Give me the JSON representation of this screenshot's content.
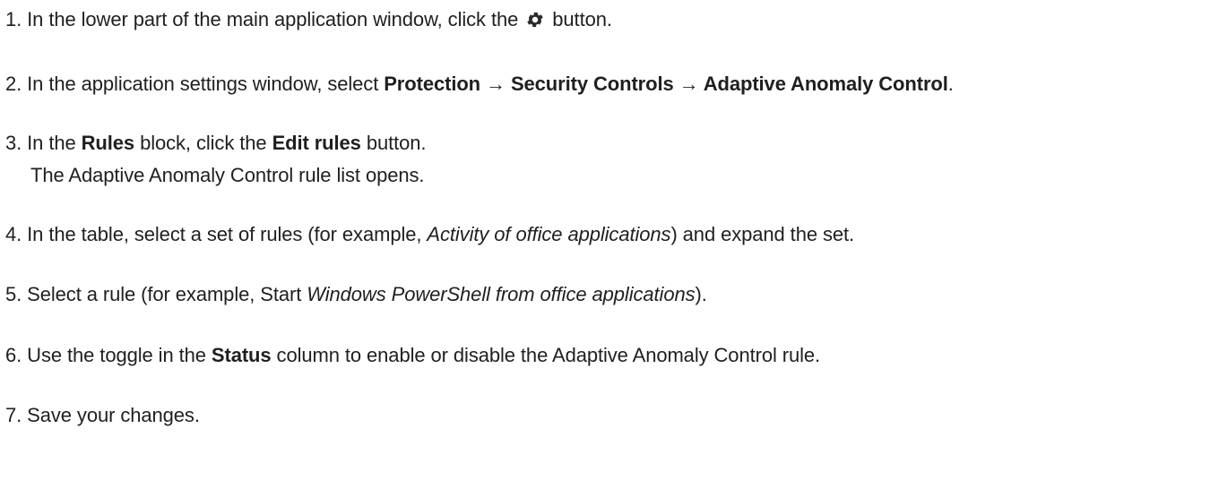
{
  "steps": [
    {
      "num": "1.",
      "a": "In the lower part of the main application window, click the",
      "icon": "gear-icon",
      "b": "button."
    },
    {
      "num": "2.",
      "a": "In the application settings window, select",
      "path": "Protection → Security Controls → Adaptive Anomaly Control",
      "end": "."
    },
    {
      "num": "3.",
      "a": "In the",
      "bold1": "Rules",
      "b": "block, click the",
      "bold2": "Edit rules",
      "c": "button.",
      "sub": "The Adaptive Anomaly Control rule list opens."
    },
    {
      "num": "4.",
      "a": "In the table, select a set of rules (for example,",
      "italic": "Activity of office applications",
      "b": ") and expand the set."
    },
    {
      "num": "5.",
      "a": "Select a rule (for example, Start",
      "italic": "Windows PowerShell from office applications",
      "b": ")."
    },
    {
      "num": "6.",
      "a": "Use the toggle in the",
      "bold1": "Status",
      "b": "column to enable or disable the Adaptive Anomaly Control rule."
    },
    {
      "num": "7.",
      "a": "Save your changes."
    }
  ],
  "colors": {
    "text": "#1f1f1f",
    "gear": "#2b2b2b"
  }
}
